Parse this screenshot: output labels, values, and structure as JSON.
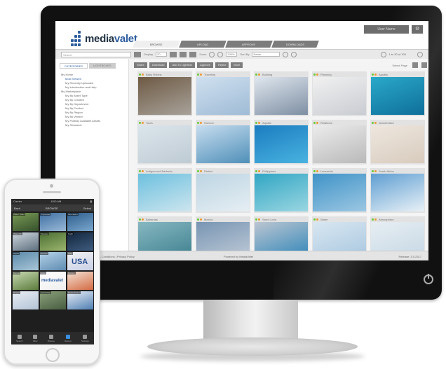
{
  "app": {
    "brand": "media",
    "brand_suffix": "valet",
    "user_button": "User Name",
    "tabs": [
      "BROWSE",
      "UPLOAD",
      "APPROVE",
      "DOWNLOADS"
    ]
  },
  "toolbar": {
    "search_placeholder": "Search",
    "display_label": "Display",
    "display_value": "20",
    "zoom_label": "Zoom",
    "zoom_value": "100%",
    "sort_label": "Sort By",
    "sort_value": "Name",
    "pager": "1 to 20 of 100"
  },
  "sidebar": {
    "tabs": [
      "CATEGORIES",
      "LIGHTBOXES"
    ],
    "items": [
      {
        "label": "My Home",
        "level": 0,
        "selected": false
      },
      {
        "label": "Most Viewed",
        "level": 1,
        "selected": true
      },
      {
        "label": "My Recently Uploaded",
        "level": 1,
        "selected": false
      },
      {
        "label": "My Introduction and Help",
        "level": 1,
        "selected": false
      },
      {
        "label": "My Marketplace",
        "level": 0,
        "selected": false
      },
      {
        "label": "My By Asset Type",
        "level": 1,
        "selected": false
      },
      {
        "label": "My By Creative",
        "level": 1,
        "selected": false
      },
      {
        "label": "My By Department",
        "level": 1,
        "selected": false
      },
      {
        "label": "My By Product",
        "level": 1,
        "selected": false
      },
      {
        "label": "My By Region",
        "level": 1,
        "selected": false
      },
      {
        "label": "My By Vendor",
        "level": 1,
        "selected": false
      },
      {
        "label": "My Publicly Available Assets",
        "level": 1,
        "selected": false
      },
      {
        "label": "My Research",
        "level": 1,
        "selected": false
      }
    ]
  },
  "actions": {
    "buttons": [
      "Share",
      "Download",
      "Add To Lightbox",
      "Approve",
      "Reject",
      "More"
    ],
    "select_page": "Select Page"
  },
  "grid": [
    {
      "label": "Baby Robins",
      "colors": [
        "#6e5a44",
        "#a8a29a"
      ]
    },
    {
      "label": "Traveling",
      "colors": [
        "#cfe0ef",
        "#9fbbd6"
      ]
    },
    {
      "label": "Building",
      "colors": [
        "#dfe6ee",
        "#7e8fa3"
      ]
    },
    {
      "label": "Planning",
      "colors": [
        "#f1f1f1",
        "#c9ccd2"
      ]
    },
    {
      "label": "Aquatic",
      "colors": [
        "#2aa9c9",
        "#0f6f9a"
      ]
    },
    {
      "label": "Tours",
      "colors": [
        "#dbe5ec",
        "#bfcbd3"
      ]
    },
    {
      "label": "Horizon",
      "colors": [
        "#c7ddef",
        "#4f8fb8"
      ]
    },
    {
      "label": "Aquatic",
      "colors": [
        "#1b7cc0",
        "#49b3e0"
      ]
    },
    {
      "label": "Relations",
      "colors": [
        "#ececec",
        "#b9b9b9"
      ]
    },
    {
      "label": "Wonderland",
      "colors": [
        "#eee7df",
        "#d8cbbd"
      ]
    },
    {
      "label": "Antigua and Barbuda",
      "colors": [
        "#6cc0df",
        "#cde5ee"
      ]
    },
    {
      "label": "District",
      "colors": [
        "#bcd5e3",
        "#e6eef3"
      ]
    },
    {
      "label": "Philippines",
      "colors": [
        "#31a6c4",
        "#9ad6e1"
      ]
    },
    {
      "label": "Lanzarote",
      "colors": [
        "#3f93c8",
        "#9cc7e2"
      ]
    },
    {
      "label": "South Africa",
      "colors": [
        "#5e9ed2",
        "#e9f1f6"
      ]
    },
    {
      "label": "Bahamas",
      "colors": [
        "#87b8c1",
        "#3c7e8e"
      ]
    },
    {
      "label": "Mexico",
      "colors": [
        "#7895b3",
        "#c1ccd8"
      ]
    },
    {
      "label": "Sand Lucia",
      "colors": [
        "#bcc6d1",
        "#2c84b8"
      ]
    },
    {
      "label": "Water",
      "colors": [
        "#d9e7f1",
        "#a7c6df"
      ]
    },
    {
      "label": "Atmosphere",
      "colors": [
        "#e7eef3",
        "#c5d7e4"
      ]
    }
  ],
  "footer": {
    "left": "Terms & Conditions | Privacy Policy",
    "mid": "Powered by MediaValet",
    "right": "Release: 3.0.2317"
  },
  "phone": {
    "carrier": "Carrier",
    "time": "8:00 AM",
    "nav_left": "Back",
    "nav_title": "BROWSE",
    "nav_right": "Select",
    "usa_text": "USA",
    "brand_text": "mediavalet",
    "tiles": [
      {
        "cap": "Water Road",
        "colors": [
          "#7a9b55",
          "#35502c"
        ]
      },
      {
        "cap": "Cityscape",
        "colors": [
          "#3f6fa3",
          "#99b9d6"
        ]
      },
      {
        "cap": "Mountains",
        "colors": [
          "#2d5d8c",
          "#7aa7ce"
        ]
      },
      {
        "cap": "Waterfall",
        "colors": [
          "#cfd7de",
          "#5d6f7d"
        ]
      },
      {
        "cap": "Meadow",
        "colors": [
          "#4a6e33",
          "#9bb56d"
        ]
      },
      {
        "cap": "Night",
        "colors": [
          "#13263d",
          "#3e5c7f"
        ]
      },
      {
        "cap": "Aerial",
        "colors": [
          "#5b8aa9",
          "#a9c6d8"
        ]
      },
      {
        "cap": "Horizon",
        "colors": [
          "#b5d3e8",
          "#5f8bb1"
        ]
      },
      {
        "cap": "Flag",
        "colors": [
          "#f2f2f2",
          "#c8d0e6"
        ]
      },
      {
        "cap": "Bonsai",
        "colors": [
          "#c8d8b2",
          "#5b7c3c"
        ]
      },
      {
        "cap": "Logo",
        "colors": [
          "#ffffff",
          "#eeeeee"
        ]
      },
      {
        "cap": "Berries",
        "colors": [
          "#f3e3d6",
          "#d46a42"
        ]
      },
      {
        "cap": "Report",
        "colors": [
          "#e8edf3",
          "#b3c3d6"
        ]
      },
      {
        "cap": "Aerial Map",
        "colors": [
          "#8aa07b",
          "#485d40"
        ]
      },
      {
        "cap": "Presentation",
        "colors": [
          "#e9eef4",
          "#4f7fb4"
        ]
      }
    ],
    "tabbar": [
      "Search",
      "Filter",
      "Browse",
      "Recent",
      "Settings"
    ]
  }
}
